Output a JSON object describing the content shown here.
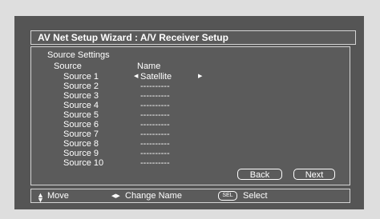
{
  "title": "AV Net Setup Wizard : A/V Receiver Setup",
  "section_title": "Source Settings",
  "columns": {
    "source": "Source",
    "name": "Name"
  },
  "sources": [
    {
      "label": "Source 1",
      "name": "Satellite"
    },
    {
      "label": "Source 2",
      "name": "----------"
    },
    {
      "label": "Source 3",
      "name": "----------"
    },
    {
      "label": "Source 4",
      "name": "----------"
    },
    {
      "label": "Source 5",
      "name": "----------"
    },
    {
      "label": "Source 6",
      "name": "----------"
    },
    {
      "label": "Source 7",
      "name": "----------"
    },
    {
      "label": "Source 8",
      "name": "----------"
    },
    {
      "label": "Source 9",
      "name": "----------"
    },
    {
      "label": "Source 10",
      "name": "----------"
    }
  ],
  "buttons": {
    "back": "Back",
    "next": "Next"
  },
  "help": {
    "move": "Move",
    "change_name": "Change Name",
    "select_key": "SEL",
    "select": "Select"
  },
  "icons": {
    "move": "up-down-arrows-icon",
    "change_name": "left-right-arrows-icon",
    "selection_left": "arrow-left-icon",
    "selection_right": "arrow-right-icon"
  },
  "colors": {
    "background": "#555555",
    "text": "#ffffff",
    "border": "#d4d4d4",
    "outer": "#dedede"
  }
}
